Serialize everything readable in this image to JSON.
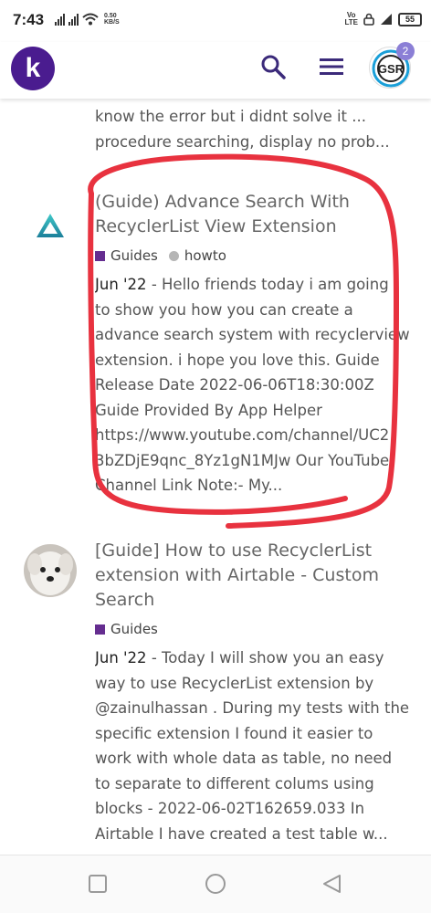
{
  "status_bar": {
    "time": "7:43",
    "speed_value": "0.50",
    "speed_unit": "KB/S",
    "volte_top": "Vo",
    "volte_bottom": "LTE",
    "battery": "55"
  },
  "header": {
    "logo_letter": "k",
    "notification_count": "2",
    "avatar_text": "GSR"
  },
  "previous_post": {
    "excerpt_lines": [
      "know the error but i didnt solve it ...",
      "procedure searching, display no prob..."
    ]
  },
  "posts": [
    {
      "title_lines": [
        "(Guide) Advance Search With",
        "RecyclerList View Extension"
      ],
      "category": "Guides",
      "tag": "howto",
      "date": "Jun '22",
      "excerpt_first": "- Hello friends today i am going",
      "excerpt_lines": [
        "to show you how you can create a",
        "advance search system with recyclerview",
        "extension. i hope you love this. Guide",
        "Release Date 2022-06-06T18:30:00Z",
        "Guide Provided By App Helper",
        "https://www.youtube.com/channel/UC2",
        "3bZDjE9qnc_8Yz1gN1MJw Our YouTube",
        "Channel Link Note:- My..."
      ]
    },
    {
      "title_lines": [
        "[Guide] How to use RecyclerList",
        "extension with Airtable - Custom",
        "Search"
      ],
      "category": "Guides",
      "date": "Jun '22",
      "excerpt_first": "- Today I will show you an easy",
      "excerpt_lines": [
        "way to use RecyclerList extension by",
        "@zainulhassan . During my tests with the",
        "specific extension I found it easier to",
        "work with whole data as table, no need",
        "to separate to different colums using",
        "blocks - 2022-06-02T162659.033 In",
        "Airtable I have created a test table w..."
      ]
    }
  ],
  "colors": {
    "brand": "#4a1c8f",
    "category": "#652d90",
    "annotation": "#e8323f",
    "tag_dot": "#b5b5b5"
  }
}
